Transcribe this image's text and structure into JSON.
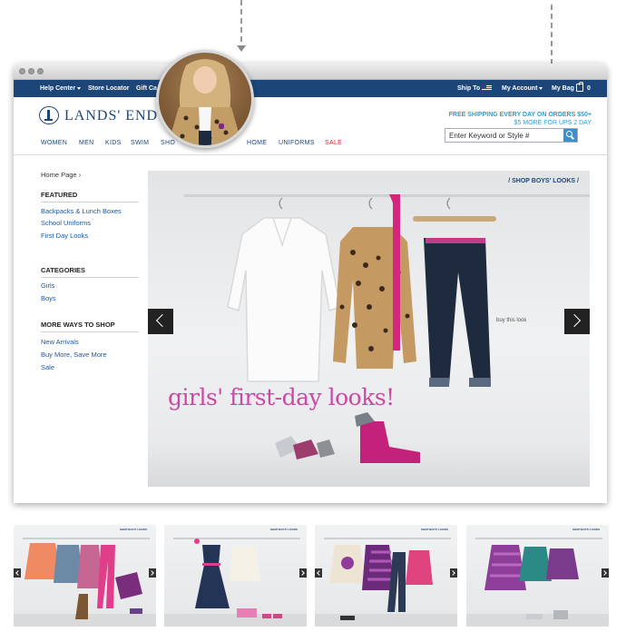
{
  "topbar": {
    "help_center": "Help Center",
    "store_locator": "Store Locator",
    "gift_cards": "Gift Ca",
    "ship_to": "Ship To",
    "my_account": "My Account",
    "my_bag": "My Bag",
    "bag_count": "0"
  },
  "header": {
    "logo": "LANDS' END",
    "promo_line1": "FREE SHIPPING EVERY DAY ON ORDERS $50+",
    "promo_line2": "$5 MORE FOR UPS 2 DAY",
    "search_placeholder": "Enter Keyword or Style #",
    "nav": [
      "WOMEN",
      "MEN",
      "KIDS",
      "SWIM",
      "SHO",
      "HOME",
      "UNIFORMS",
      "SALE"
    ]
  },
  "sidebar": {
    "breadcrumb": "Home Page",
    "featured_title": "FEATURED",
    "featured_links": [
      "Backpacks & Lunch Boxes",
      "School Uniforms",
      "First Day Looks"
    ],
    "categories_title": "CATEGORIES",
    "category_links": [
      "Girls",
      "Boys"
    ],
    "more_title": "MORE WAYS TO SHOP",
    "more_links": [
      "New Arrivals",
      "Buy More, Save More",
      "Sale"
    ]
  },
  "hero": {
    "breadcrumb": "/ SHOP BOYS' LOOKS /",
    "caption": "girls' first-day looks!",
    "buy_this_look": "buy this look"
  },
  "thumbnails": {
    "crumb": "SHOP BOYS' LOOKS"
  },
  "colors": {
    "brand_navy": "#1c4679",
    "promo_blue": "#2a9fd8",
    "sale_red": "#d2232a",
    "caption_pink": "#c94aa4"
  }
}
